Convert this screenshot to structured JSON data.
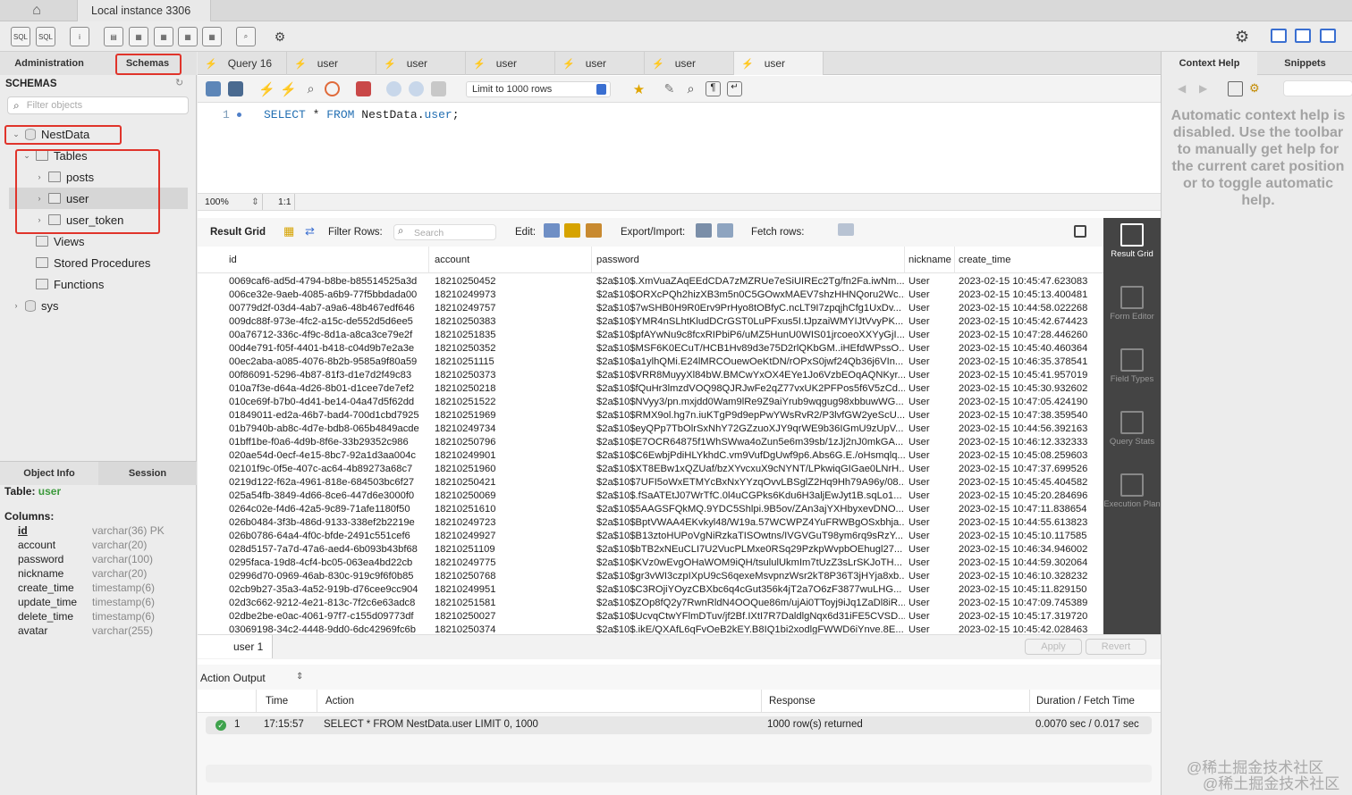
{
  "window": {
    "connection_tab": "Local instance 3306"
  },
  "sidebar": {
    "tabs": [
      "Administration",
      "Schemas"
    ],
    "schemas_header": "SCHEMAS",
    "filter_placeholder": "Filter objects",
    "tree": {
      "db": "NestData",
      "tables_label": "Tables",
      "tables": [
        "posts",
        "user",
        "user_token"
      ],
      "views": "Views",
      "procs": "Stored Procedures",
      "funcs": "Functions",
      "sys": "sys"
    },
    "info_tabs": [
      "Object Info",
      "Session"
    ],
    "table_label": "Table:",
    "table_name": "user",
    "columns_label": "Columns:",
    "columns": [
      {
        "name": "id",
        "type": "varchar(36) PK"
      },
      {
        "name": "account",
        "type": "varchar(20)"
      },
      {
        "name": "password",
        "type": "varchar(100)"
      },
      {
        "name": "nickname",
        "type": "varchar(20)"
      },
      {
        "name": "create_time",
        "type": "timestamp(6)"
      },
      {
        "name": "update_time",
        "type": "timestamp(6)"
      },
      {
        "name": "delete_time",
        "type": "timestamp(6)"
      },
      {
        "name": "avatar",
        "type": "varchar(255)"
      }
    ]
  },
  "query_tabs": [
    "Query 16",
    "user",
    "user",
    "user",
    "user",
    "user",
    "user"
  ],
  "sql_toolbar": {
    "limit": "Limit to 1000 rows"
  },
  "editor": {
    "line": "1",
    "kw1": "SELECT",
    "star": "*",
    "kw2": "FROM",
    "schema": "NestData.",
    "table": "user",
    "semi": ";"
  },
  "zoom": {
    "level": "100%",
    "ratio": "1:1"
  },
  "result_toolbar": {
    "result_grid": "Result Grid",
    "filter_rows": "Filter Rows:",
    "search_placeholder": "Search",
    "edit": "Edit:",
    "export": "Export/Import:",
    "fetch": "Fetch rows:"
  },
  "grid": {
    "columns": [
      "id",
      "account",
      "password",
      "nickname",
      "create_time"
    ],
    "rows": [
      [
        "0069caf6-ad5d-4794-b8be-b85514525a3d",
        "18210250452",
        "$2a$10$.XmVuaZAqEEdCDA7zMZRUe7eSiUIREc2Tg/fn2Fa.iwNm...",
        "User",
        "2023-02-15 10:45:47.623083"
      ],
      [
        "006ce32e-9aeb-4085-a6b9-77f5bbdada00",
        "18210249973",
        "$2a$10$ORXcPQh2hizXB3m5n0C5GOwxMAEV7shzHHNQoru2Wc...",
        "User",
        "2023-02-15 10:45:13.400481"
      ],
      [
        "00779d2f-03d4-4ab7-a9a6-48b467edf646",
        "18210249757",
        "$2a$10$7wSHB0H9R0Erv9PrHyo8tOBfyC.ncLT9I7zpqjhCfg1UxDv...",
        "User",
        "2023-02-15 10:44:58.022268"
      ],
      [
        "009dc88f-973e-4fc2-a15c-de552d5d6ee5",
        "18210250383",
        "$2a$10$YMR4nSLhtKludDCrGST0LuPFxus5I.tJpzaiWMYIJtVvyPK...",
        "User",
        "2023-02-15 10:45:42.674423"
      ],
      [
        "00a76712-336c-4f9c-8d1a-a8ca3ce79e2f",
        "18210251835",
        "$2a$10$pfAYwNu9c8fcxRIPbiP6/uMZ5HunU0WIS01jrcoeoXXYyGjI...",
        "User",
        "2023-02-15 10:47:28.446260"
      ],
      [
        "00d4e791-f05f-4401-b418-c04d9b7e2a3e",
        "18210250352",
        "$2a$10$MSF6K0ECuT/HCB1Hv89d3e75D2rlQKbGM..iHEfdWPssO...",
        "User",
        "2023-02-15 10:45:40.460364"
      ],
      [
        "00ec2aba-a085-4076-8b2b-9585a9f80a59",
        "18210251115",
        "$2a$10$a1ylhQMi.E24lMRCOuewOeKtDN/rOPxS0jwf24Qb36j6VIn...",
        "User",
        "2023-02-15 10:46:35.378541"
      ],
      [
        "00f86091-5296-4b87-81f3-d1e7d2f49c83",
        "18210250373",
        "$2a$10$VRR8MuyyXl84bW.BMCwYxOX4EYe1Jo6VzbEOqAQNKyr...",
        "User",
        "2023-02-15 10:45:41.957019"
      ],
      [
        "010a7f3e-d64a-4d26-8b01-d1cee7de7ef2",
        "18210250218",
        "$2a$10$fQuHr3lmzdVOQ98QJRJwFe2qZ77vxUK2PFPos5f6V5zCd...",
        "User",
        "2023-02-15 10:45:30.932602"
      ],
      [
        "010ce69f-b7b0-4d41-be14-04a47d5f62dd",
        "18210251522",
        "$2a$10$NVyy3/pn.mxjdd0Wam9lRe9Z9aiYrub9wqgug98xbbuwWG...",
        "User",
        "2023-02-15 10:47:05.424190"
      ],
      [
        "01849011-ed2a-46b7-bad4-700d1cbd7925",
        "18210251969",
        "$2a$10$RMX9ol.hg7n.iuKTgP9d9epPwYWsRvR2/P3lvfGW2yeScU...",
        "User",
        "2023-02-15 10:47:38.359540"
      ],
      [
        "01b7940b-ab8c-4d7e-bdb8-065b4849acde",
        "18210249734",
        "$2a$10$eyQPp7TbOlrSxNhY72GZzuoXJY9qrWE9b36IGmU9zUpV...",
        "User",
        "2023-02-15 10:44:56.392163"
      ],
      [
        "01bff1be-f0a6-4d9b-8f6e-33b29352c986",
        "18210250796",
        "$2a$10$E7OCR64875f1WhSWwa4oZun5e6m39sb/1zJj2nJ0mkGA...",
        "User",
        "2023-02-15 10:46:12.332333"
      ],
      [
        "020ae54d-0ecf-4e15-8bc7-92a1d3aa004c",
        "18210249901",
        "$2a$10$C6EwbjPdiHLYkhdC.vm9VufDgUwf9p6.Abs6G.E./oHsmqlq...",
        "User",
        "2023-02-15 10:45:08.259603"
      ],
      [
        "02101f9c-0f5e-407c-ac64-4b89273a68c7",
        "18210251960",
        "$2a$10$XT8EBw1xQZUaf/bzXYvcxuX9cNYNT/LPkwiqGIGae0LNrH...",
        "User",
        "2023-02-15 10:47:37.699526"
      ],
      [
        "0219d122-f62a-4961-818e-684503bc6f27",
        "18210250421",
        "$2a$10$7UFI5oWxETMYcBxNxYYzqOvvLBSglZ2Hq9Hh79A96y/08...",
        "User",
        "2023-02-15 10:45:45.404582"
      ],
      [
        "025a54fb-3849-4d66-8ce6-447d6e3000f0",
        "18210250069",
        "$2a$10$.fSaATEtJ07WrTfC.0l4uCGPks6Kdu6H3aljEwJyt1B.sqLo1...",
        "User",
        "2023-02-15 10:45:20.284696"
      ],
      [
        "0264c02e-f4d6-42a5-9c89-71afe1180f50",
        "18210251610",
        "$2a$10$5AAGSFQkMQ.9YDC5Shlpi.9B5ov/ZAn3ajYXHbyxevDNO...",
        "User",
        "2023-02-15 10:47:11.838654"
      ],
      [
        "026b0484-3f3b-486d-9133-338ef2b2219e",
        "18210249723",
        "$2a$10$BptVWAA4EKvkyl48/W19a.57WCWPZ4YuFRWBgOSxbhja...",
        "User",
        "2023-02-15 10:44:55.613823"
      ],
      [
        "026b0786-64a4-4f0c-bfde-2491c551cef6",
        "18210249927",
        "$2a$10$B13ztoHUPoVgNiRzkaTISOwtns/IVGVGuT98ym6rq9sRzY...",
        "User",
        "2023-02-15 10:45:10.117585"
      ],
      [
        "028d5157-7a7d-47a6-aed4-6b093b43bf68",
        "18210251109",
        "$2a$10$bTB2xNEuCLI7U2VucPLMxe0RSq29PzkpWvpbOEhugl27...",
        "User",
        "2023-02-15 10:46:34.946002"
      ],
      [
        "0295faca-19d8-4cf4-bc05-063ea4bd22cb",
        "18210249775",
        "$2a$10$KVz0wEvgOHaWOM9iQH/tsululUkmIm7tUzZ3sLrSKJoTH...",
        "User",
        "2023-02-15 10:44:59.302064"
      ],
      [
        "02996d70-0969-46ab-830c-919c9f6f0b85",
        "18210250768",
        "$2a$10$gr3vWI3czpIXpU9cS6qexeMsvpnzWsr2kT8P36T3jHYja8xb...",
        "User",
        "2023-02-15 10:46:10.328232"
      ],
      [
        "02cb9b27-35a3-4a52-919b-d76cee9cc904",
        "18210249951",
        "$2a$10$C3ROjiYOyzCBXbc6q4cGut356k4jT2a7O6zF3877wuLHG...",
        "User",
        "2023-02-15 10:45:11.829150"
      ],
      [
        "02d3c662-9212-4e21-813c-7f2c6e63adc8",
        "18210251581",
        "$2a$10$ZOp8fQ2y7RwnRldN4OOQue86m/ujAi0TToyj9iJq1ZaDl8iR...",
        "User",
        "2023-02-15 10:47:09.745389"
      ],
      [
        "02dbe2be-e0ac-4061-97f7-c155d09773df",
        "18210250027",
        "$2a$10$UcvqCtwYFlmDTuv/jf2Bf.IXtI7R7DaldlgNqx6d31iFE5CVSD...",
        "User",
        "2023-02-15 10:45:17.319720"
      ],
      [
        "03069198-34c2-4448-9dd0-6dc42969fc6b",
        "18210250374",
        "$2a$10$.ikE/QXAfL6qFvOeB2kEY.B8IQ1bi2xodlgFWWD6iYnve.8E...",
        "User",
        "2023-02-15 10:45:42.028463"
      ]
    ]
  },
  "rail": [
    "Result Grid",
    "Form Editor",
    "Field Types",
    "Query Stats",
    "Execution Plan"
  ],
  "grid_footer": {
    "tab": "user 1",
    "apply": "Apply",
    "revert": "Revert"
  },
  "action_output": {
    "label": "Action Output",
    "headers": [
      "Time",
      "Action",
      "Response",
      "Duration / Fetch Time"
    ],
    "row": {
      "num": "1",
      "time": "17:15:57",
      "action": "SELECT * FROM NestData.user LIMIT 0, 1000",
      "response": "1000 row(s) returned",
      "duration": "0.0070 sec / 0.017 sec"
    }
  },
  "right_panel": {
    "tabs": [
      "Context Help",
      "Snippets"
    ],
    "help": "Automatic context help is disabled. Use the toolbar to manually get help for the current caret position or to toggle automatic help."
  },
  "watermark": "@稀土掘金技术社区"
}
